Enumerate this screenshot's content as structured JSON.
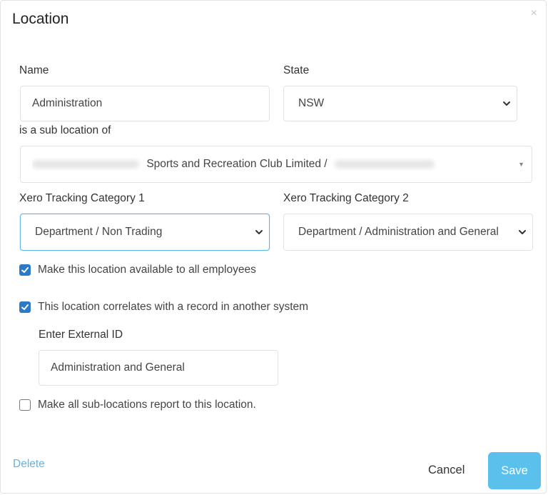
{
  "dialog": {
    "title": "Location",
    "close_symbol": "×"
  },
  "form": {
    "name_label": "Name",
    "name_value": "Administration",
    "state_label": "State",
    "state_value": "NSW",
    "sublocation_label": "is a sub location of",
    "sublocation_visible_text": "Sports and Recreation Club Limited /",
    "xero1_label": "Xero Tracking Category 1",
    "xero1_value": "Department / Non Trading",
    "xero2_label": "Xero Tracking Category 2",
    "xero2_value": "Department / Administration and General",
    "checkbox_all_employees": {
      "label": "Make this location available to all employees",
      "checked": true
    },
    "checkbox_correlates": {
      "label": "This location correlates with a record in another system",
      "checked": true
    },
    "external_id_label": "Enter External ID",
    "external_id_value": "Administration and General",
    "checkbox_sub_locations": {
      "label": "Make all sub-locations report to this location.",
      "checked": false
    }
  },
  "footer": {
    "delete_label": "Delete",
    "cancel_label": "Cancel",
    "save_label": "Save"
  },
  "colors": {
    "accent": "#5cb6e6",
    "checkbox": "#2a7ac9",
    "save_button": "#5cc0ec"
  },
  "icons": {
    "close": "close-icon",
    "select_arrow": "chevron-down-icon",
    "check": "check-icon"
  }
}
